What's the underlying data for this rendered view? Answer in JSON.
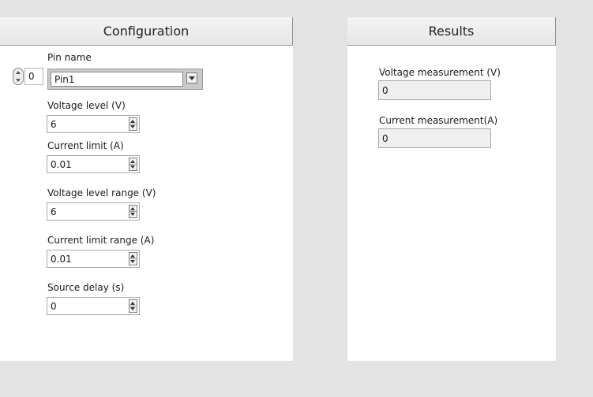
{
  "configuration": {
    "tab_label": "Configuration",
    "array_index": "0",
    "pin_name": {
      "label": "Pin name",
      "value": "Pin1"
    },
    "voltage_level": {
      "label": "Voltage level (V)",
      "value": "6"
    },
    "current_limit": {
      "label": "Current limit (A)",
      "value": "0.01"
    },
    "voltage_level_range": {
      "label": "Voltage level range (V)",
      "value": "6"
    },
    "current_limit_range": {
      "label": "Current limit range (A)",
      "value": "0.01"
    },
    "source_delay": {
      "label": "Source delay (s)",
      "value": "0"
    }
  },
  "results": {
    "tab_label": "Results",
    "voltage_measurement": {
      "label": "Voltage measurement (V)",
      "value": "0"
    },
    "current_measurement": {
      "label": "Current measurement(A)",
      "value": "0"
    }
  },
  "icons": {
    "spinner": "up-down-arrows",
    "dropdown": "chevron-down-icon"
  }
}
